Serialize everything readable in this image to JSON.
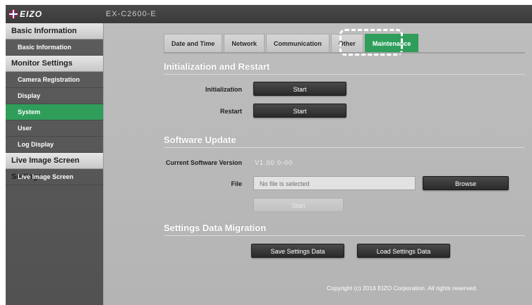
{
  "header": {
    "logo_text": "EIZO",
    "device_name": "EX-C2600-E"
  },
  "sidebar": {
    "sections": [
      {
        "title": "Basic Information",
        "items": [
          "Basic Information"
        ]
      },
      {
        "title": "Monitor Settings",
        "items": [
          "Camera Registration",
          "Display",
          "System",
          "User",
          "Log Display"
        ]
      },
      {
        "title": "Live Image Screen Settings",
        "items": [
          "Live Image Screen"
        ]
      }
    ],
    "active_item": "System"
  },
  "tabs": {
    "labels": [
      "Date and Time",
      "Network",
      "Communication",
      "Other",
      "Maintenance"
    ],
    "active": "Maintenance"
  },
  "init": {
    "title": "Initialization and Restart",
    "initialization_label": "Initialization",
    "initialization_button": "Start",
    "restart_label": "Restart",
    "restart_button": "Start"
  },
  "software": {
    "title": "Software Update",
    "version_label": "Current Software Version",
    "version_value": "V1.00 0-00",
    "file_label": "File",
    "file_placeholder": "No file is selected",
    "browse_button": "Browse",
    "start_button": "Start"
  },
  "migration": {
    "title": "Settings Data Migration",
    "save_button": "Save Settings Data",
    "load_button": "Load Settings Data"
  },
  "footer": {
    "copyright": "Copyright (c) 2016 EIZO Corporation. All rights reserved."
  },
  "colors": {
    "accent": "#2e9e5a",
    "sidebar_bg": "#5a5a5a",
    "main_bg": "#b9b9b9"
  }
}
